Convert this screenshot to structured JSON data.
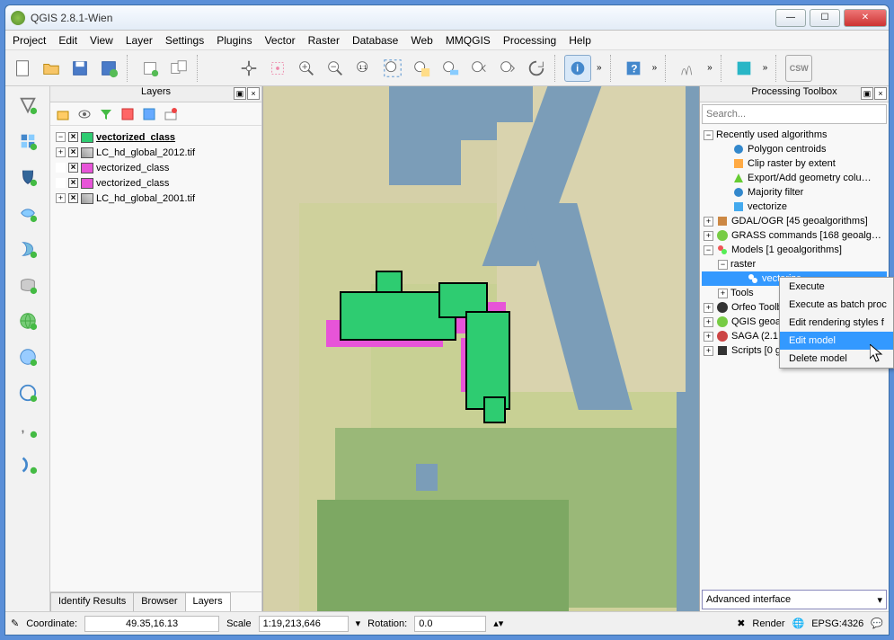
{
  "window": {
    "title": "QGIS 2.8.1-Wien"
  },
  "menu": [
    "Project",
    "Edit",
    "View",
    "Layer",
    "Settings",
    "Plugins",
    "Vector",
    "Raster",
    "Database",
    "Web",
    "MMQGIS",
    "Processing",
    "Help"
  ],
  "panels": {
    "layers_title": "Layers",
    "toolbox_title": "Processing Toolbox",
    "search_placeholder": "Search...",
    "advanced": "Advanced interface"
  },
  "layers": [
    {
      "exp": "-",
      "sw": "#2ecc71",
      "name": "vectorized_class",
      "bold": true
    },
    {
      "exp": "+",
      "sw": "grad",
      "name": "LC_hd_global_2012.tif"
    },
    {
      "exp": "",
      "sw": "#e754d8",
      "name": "vectorized_class"
    },
    {
      "exp": "",
      "sw": "#e754d8",
      "name": "vectorized_class"
    },
    {
      "exp": "+",
      "sw": "grad",
      "name": "LC_hd_global_2001.tif"
    }
  ],
  "layer_tabs": [
    "Identify Results",
    "Browser",
    "Layers"
  ],
  "toolbox": {
    "recent_label": "Recently used algorithms",
    "recent": [
      "Polygon centroids",
      "Clip raster by extent",
      "Export/Add geometry colu…",
      "Majority filter",
      "vectorize"
    ],
    "providers": [
      "GDAL/OGR [45 geoalgorithms]",
      "GRASS commands [168 geoalg…",
      "Models [1 geoalgorithms]",
      "Orfeo Toolb",
      "QGIS geoa",
      "SAGA (2.1",
      "Scripts [0 g"
    ],
    "model_group": "raster",
    "model_item": "vectorize",
    "tools_label": "Tools"
  },
  "context_menu": [
    "Execute",
    "Execute as batch proc",
    "Edit rendering styles f",
    "Edit model",
    "Delete model"
  ],
  "status": {
    "coord_label": "Coordinate:",
    "coord_value": "49.35,16.13",
    "scale_label": "Scale",
    "scale_value": "1:19,213,646",
    "rotation_label": "Rotation:",
    "rotation_value": "0.0",
    "render_label": "Render",
    "crs": "EPSG:4326"
  }
}
